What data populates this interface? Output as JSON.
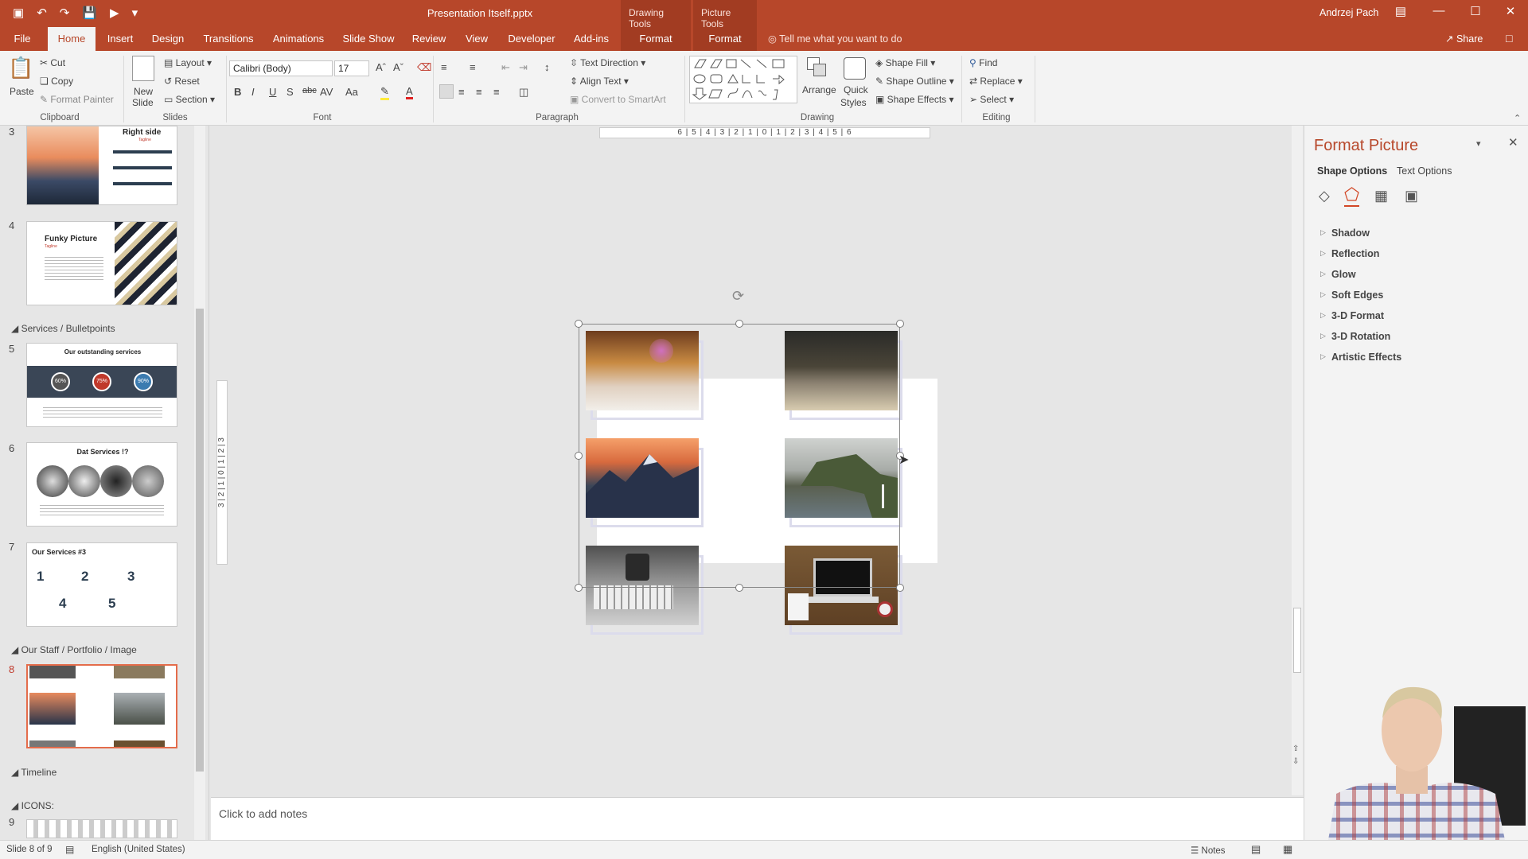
{
  "window": {
    "file_title": "Presentation Itself.pptx",
    "ctx_drawing": "Drawing Tools",
    "ctx_picture": "Picture Tools",
    "user": "Andrzej Pach"
  },
  "tabs": [
    {
      "label": "File"
    },
    {
      "label": "Home"
    },
    {
      "label": "Insert"
    },
    {
      "label": "Design"
    },
    {
      "label": "Transitions"
    },
    {
      "label": "Animations"
    },
    {
      "label": "Slide Show"
    },
    {
      "label": "Review"
    },
    {
      "label": "View"
    },
    {
      "label": "Developer"
    },
    {
      "label": "Add-ins"
    },
    {
      "label": "Format"
    },
    {
      "label": "Format"
    }
  ],
  "tell_me": "Tell me what you want to do",
  "share": "Share",
  "ribbon": {
    "clipboard": {
      "paste": "Paste",
      "cut": "Cut",
      "copy": "Copy",
      "format_painter": "Format Painter",
      "label": "Clipboard"
    },
    "slides": {
      "new_slide_1": "New",
      "new_slide_2": "Slide",
      "layout": "Layout",
      "reset": "Reset",
      "section": "Section",
      "label": "Slides"
    },
    "font": {
      "name": "Calibri (Body)",
      "size": "17",
      "label": "Font"
    },
    "paragraph": {
      "text_direction": "Text Direction",
      "align_text": "Align Text",
      "convert_smartart": "Convert to SmartArt",
      "label": "Paragraph"
    },
    "drawing": {
      "arrange": "Arrange",
      "quick_styles_1": "Quick",
      "quick_styles_2": "Styles",
      "shape_fill": "Shape Fill",
      "shape_outline": "Shape Outline",
      "shape_effects": "Shape Effects",
      "label": "Drawing"
    },
    "editing": {
      "find": "Find",
      "replace": "Replace",
      "select": "Select",
      "label": "Editing"
    }
  },
  "ruler": {
    "h": "6 | 5 | 4 | 3 | 2 | 1 | 0 | 1 | 2 | 3 | 4 | 5 | 6",
    "v": "3 | 2 | 1 | 0 | 1 | 2 | 3"
  },
  "slides_pane": {
    "sections": {
      "services": "Services / Bulletpoints",
      "staff": "Our Staff / Portfolio / Image",
      "timeline": "Timeline",
      "icons": "ICONS:"
    },
    "slides": [
      {
        "num": "3",
        "title": "Right side",
        "subtitle": "Tagline"
      },
      {
        "num": "4",
        "title": "Funky Picture",
        "subtitle": "Tagline"
      },
      {
        "num": "5",
        "title": "Our outstanding services",
        "p1": "60%",
        "p2": "75%",
        "p3": "90%"
      },
      {
        "num": "6",
        "title": "Dat Services !?"
      },
      {
        "num": "7",
        "title": "Our Services #3",
        "n1": "1",
        "n2": "2",
        "n3": "3",
        "n4": "4",
        "n5": "5"
      },
      {
        "num": "8"
      },
      {
        "num": "9"
      }
    ]
  },
  "format_pane": {
    "title": "Format Picture",
    "tab_shape": "Shape Options",
    "tab_text": "Text Options",
    "items": [
      "Shadow",
      "Reflection",
      "Glow",
      "Soft Edges",
      "3-D Format",
      "3-D Rotation",
      "Artistic Effects"
    ]
  },
  "notes_placeholder": "Click to add notes",
  "status": {
    "slide": "Slide 8 of 9",
    "language": "English (United States)",
    "notes": "Notes"
  },
  "colors": {
    "accent": "#b7472a",
    "selection": "#e46c4b"
  }
}
